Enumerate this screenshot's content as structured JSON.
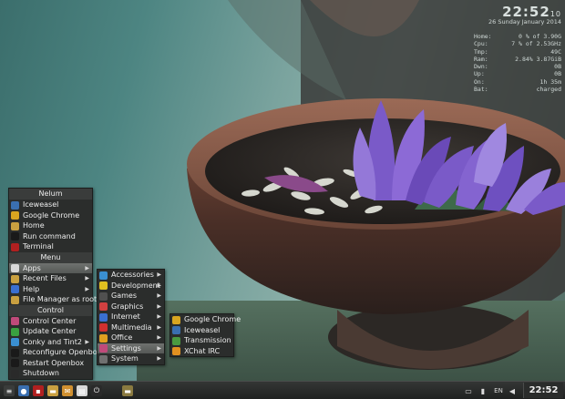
{
  "conky": {
    "time": "22:52",
    "seconds": "10",
    "date": "26 Sunday January 2014",
    "stats": [
      {
        "label": "Home:",
        "value": "0 % of 3.90G"
      },
      {
        "label": "Cpu:",
        "value": "7 % of 2.53GHz"
      },
      {
        "label": "Tmp:",
        "value": "49C"
      },
      {
        "label": "Ram:",
        "value": "2.84% 3.87GiB"
      },
      {
        "label": "Dwn:",
        "value": "0B"
      },
      {
        "label": "Up:",
        "value": "0B"
      },
      {
        "label": "On:",
        "value": "1h 35m"
      },
      {
        "label": "Bat:",
        "value": "charged"
      }
    ]
  },
  "main_menu": {
    "title": "Nelum",
    "favorites": [
      {
        "label": "Iceweasel",
        "icon": "iceweasel-icon",
        "color": "#3a6fb0"
      },
      {
        "label": "Google Chrome",
        "icon": "chrome-icon",
        "color": "#d9a520"
      },
      {
        "label": "Home",
        "icon": "home-folder-icon",
        "color": "#c9a040"
      },
      {
        "label": "Run command",
        "icon": "run-command-icon",
        "color": "#1a1a1a"
      },
      {
        "label": "Terminal",
        "icon": "terminal-icon",
        "color": "#b02020"
      }
    ],
    "menu_header": "Menu",
    "menu_items": [
      {
        "label": "Apps",
        "icon": "apps-icon",
        "color": "#d8d8d8",
        "submenu": true,
        "selected": true
      },
      {
        "label": "Recent Files",
        "icon": "recent-files-icon",
        "color": "#c9a040",
        "submenu": true
      },
      {
        "label": "Help",
        "icon": "help-icon",
        "color": "#3a6fd0",
        "submenu": true
      },
      {
        "label": "File Manager as root",
        "icon": "file-manager-icon",
        "color": "#c9a040"
      }
    ],
    "control_header": "Control",
    "control_items": [
      {
        "label": "Control Center",
        "icon": "control-center-icon",
        "color": "#c04a7a"
      },
      {
        "label": "Update Center",
        "icon": "update-center-icon",
        "color": "#3aa040"
      },
      {
        "label": "Conky and Tint2",
        "icon": "conky-icon",
        "color": "#3a8fd0",
        "submenu": true
      },
      {
        "label": "Reconfigure Openbox",
        "icon": "reconfigure-openbox-icon",
        "color": "#1a1a1a"
      },
      {
        "label": "Restart Openbox",
        "icon": "restart-openbox-icon",
        "color": "#1a1a1a"
      },
      {
        "label": "Shutdown",
        "icon": "shutdown-icon",
        "color": "#2a2a2a"
      }
    ]
  },
  "apps_menu": {
    "items": [
      {
        "label": "Accessories",
        "icon": "accessories-icon",
        "color": "#3a8fd0"
      },
      {
        "label": "Development",
        "icon": "development-icon",
        "color": "#e0c020"
      },
      {
        "label": "Games",
        "icon": "games-icon",
        "color": "#505050"
      },
      {
        "label": "Graphics",
        "icon": "graphics-icon",
        "color": "#d04040"
      },
      {
        "label": "Internet",
        "icon": "internet-icon",
        "color": "#3a6fd0"
      },
      {
        "label": "Multimedia",
        "icon": "multimedia-icon",
        "color": "#d03030"
      },
      {
        "label": "Office",
        "icon": "office-icon",
        "color": "#e0a020"
      },
      {
        "label": "Settings",
        "icon": "settings-icon",
        "color": "#c04a7a",
        "selected": true
      },
      {
        "label": "System",
        "icon": "system-icon",
        "color": "#707070"
      }
    ]
  },
  "settings_menu": {
    "items": [
      {
        "label": "Google Chrome",
        "icon": "chrome-icon",
        "color": "#d9a520"
      },
      {
        "label": "Iceweasel",
        "icon": "iceweasel-icon",
        "color": "#3a6fb0"
      },
      {
        "label": "Transmission",
        "icon": "transmission-icon",
        "color": "#4a9a40"
      },
      {
        "label": "XChat IRC",
        "icon": "xchat-icon",
        "color": "#e09020"
      }
    ]
  },
  "panel": {
    "launchers": [
      {
        "name": "menu-launcher-icon",
        "color": "#3a3c3b",
        "glyph": "≡"
      },
      {
        "name": "browser-launcher-icon",
        "color": "#3a6fb0",
        "glyph": "●"
      },
      {
        "name": "terminal-launcher-icon",
        "color": "#b02020",
        "glyph": "▪"
      },
      {
        "name": "files-launcher-icon",
        "color": "#c9a040",
        "glyph": "▬"
      },
      {
        "name": "mail-launcher-icon",
        "color": "#d09030",
        "glyph": "✉"
      },
      {
        "name": "text-editor-launcher-icon",
        "color": "#d8d8d8",
        "glyph": "▤"
      },
      {
        "name": "power-launcher-icon",
        "color": "#2a2a2a",
        "glyph": "⏻"
      }
    ],
    "task_icon": "home-folder-icon",
    "language": "EN",
    "clock": "22:52"
  }
}
